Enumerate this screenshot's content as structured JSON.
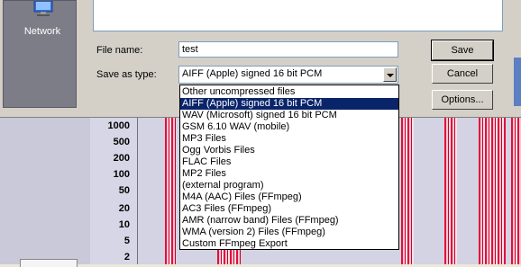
{
  "places": {
    "network_label": "Network"
  },
  "form": {
    "filename_label": "File name:",
    "filename_value": "test",
    "savetype_label": "Save as type:",
    "savetype_value": "AIFF (Apple) signed 16 bit PCM"
  },
  "buttons": {
    "save": "Save",
    "cancel": "Cancel",
    "options": "Options..."
  },
  "dropdown": {
    "selected_index": 1,
    "items": [
      "Other uncompressed files",
      "AIFF (Apple) signed 16 bit PCM",
      "WAV (Microsoft) signed 16 bit PCM",
      "GSM 6.10 WAV (mobile)",
      "MP3 Files",
      "Ogg Vorbis Files",
      "FLAC Files",
      "MP2 Files",
      "(external program)",
      "M4A (AAC) Files (FFmpeg)",
      "AC3 Files (FFmpeg)",
      "AMR (narrow band) Files (FFmpeg)",
      "WMA (version 2) Files (FFmpeg)",
      "Custom FFmpeg Export"
    ]
  },
  "scale": {
    "ticks": [
      "1000",
      "500",
      "200",
      "100",
      "50",
      "20",
      "10",
      "5",
      "2"
    ]
  },
  "colors": {
    "selection": "#0a246a",
    "spectrum": "#e0103c",
    "dialog": "#d4d0c8"
  }
}
